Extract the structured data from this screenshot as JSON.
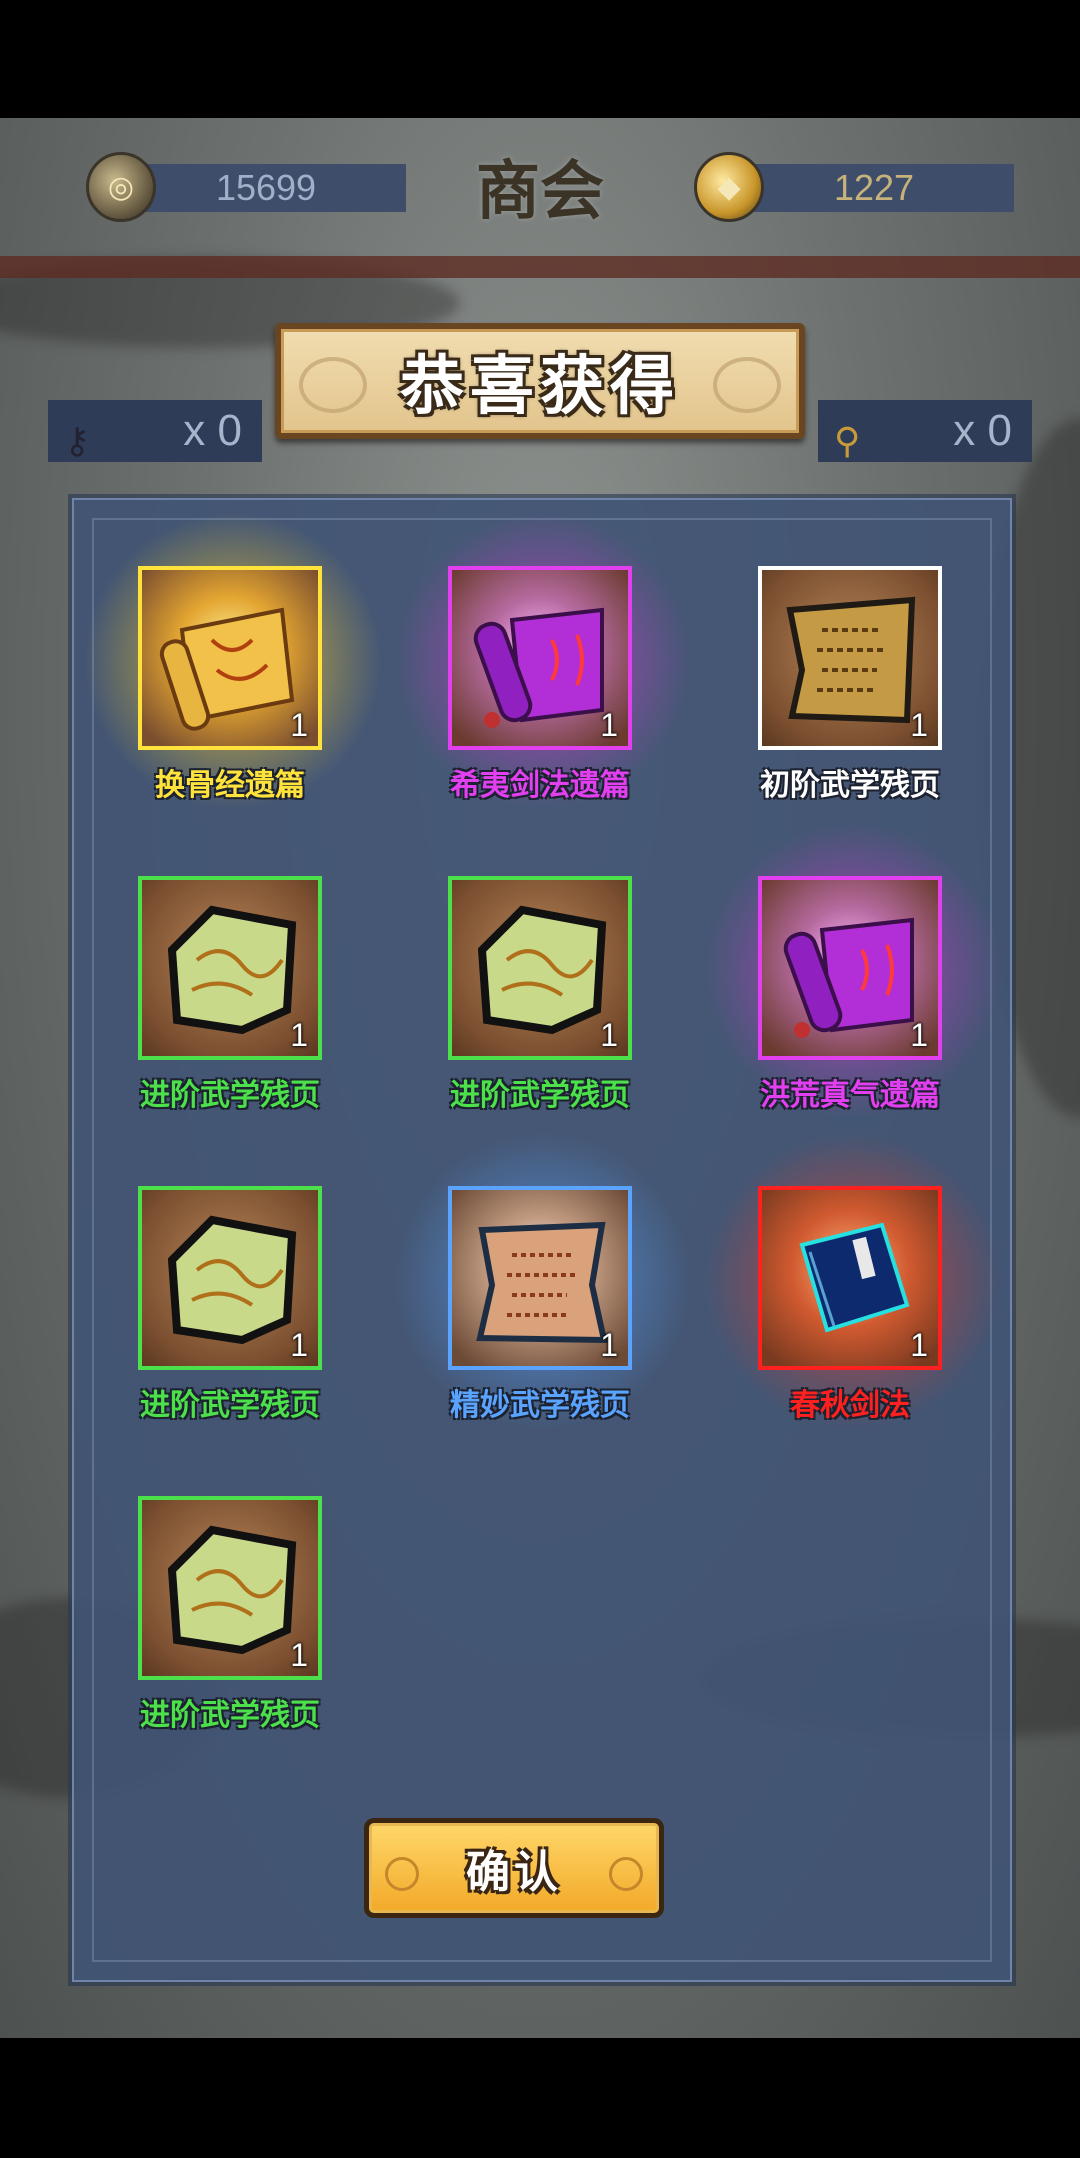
{
  "header": {
    "title": "商会",
    "copper_coins": "15699",
    "gold_ingots": "1227"
  },
  "counters": [
    {
      "icon": "key-icon",
      "value": "x 0"
    },
    {
      "icon": "magnifier-icon",
      "value": "x 0"
    }
  ],
  "reward_dialog": {
    "title": "恭喜获得",
    "items": [
      {
        "name": "换骨经遗篇",
        "qty": "1",
        "rarity": "gold",
        "color": "#ffe23a",
        "icon": "scroll-icon"
      },
      {
        "name": "希夷剑法遗篇",
        "qty": "1",
        "rarity": "purple",
        "color": "#e23ff0",
        "icon": "purple-scroll-icon"
      },
      {
        "name": "初阶武学残页",
        "qty": "1",
        "rarity": "white",
        "color": "#ffffff",
        "icon": "torn-page-icon"
      },
      {
        "name": "进阶武学残页",
        "qty": "1",
        "rarity": "green",
        "color": "#4ce04a",
        "icon": "green-page-icon"
      },
      {
        "name": "进阶武学残页",
        "qty": "1",
        "rarity": "green",
        "color": "#4ce04a",
        "icon": "green-page-icon"
      },
      {
        "name": "洪荒真气遗篇",
        "qty": "1",
        "rarity": "purple",
        "color": "#e23ff0",
        "icon": "purple-scroll-icon"
      },
      {
        "name": "进阶武学残页",
        "qty": "1",
        "rarity": "green",
        "color": "#4ce04a",
        "icon": "green-page-icon"
      },
      {
        "name": "精妙武学残页",
        "qty": "1",
        "rarity": "blue",
        "color": "#5aa4ff",
        "icon": "parchment-icon"
      },
      {
        "name": "春秋剑法",
        "qty": "1",
        "rarity": "red",
        "color": "#ff2020",
        "icon": "manual-book-icon"
      },
      {
        "name": "进阶武学残页",
        "qty": "1",
        "rarity": "green",
        "color": "#4ce04a",
        "icon": "green-page-icon"
      }
    ],
    "confirm_label": "确认"
  }
}
